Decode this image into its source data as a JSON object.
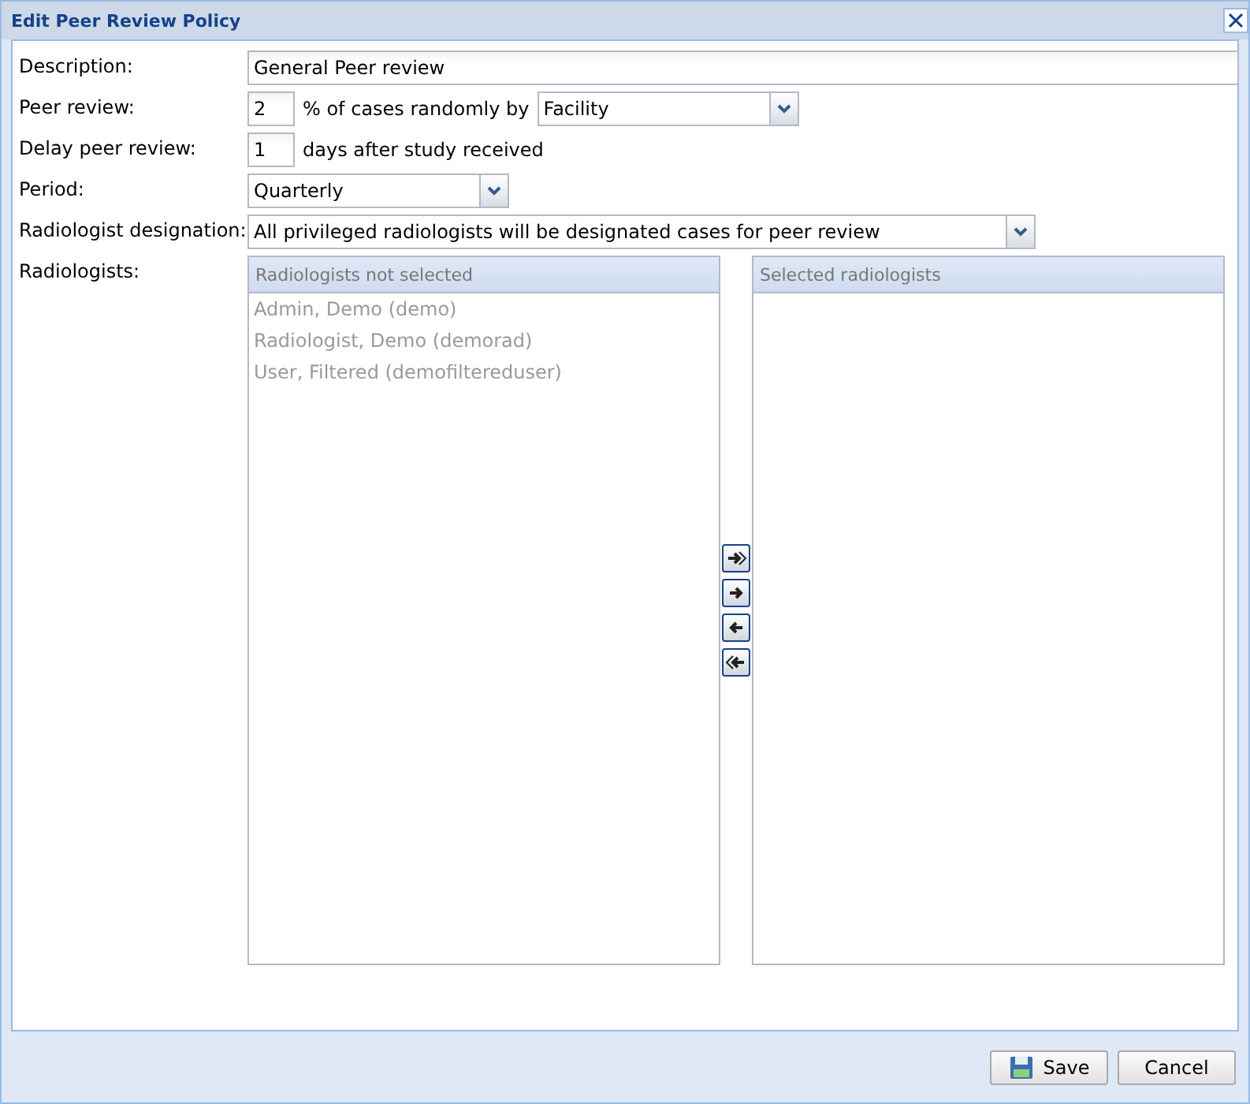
{
  "window": {
    "title": "Edit Peer Review Policy"
  },
  "form": {
    "description": {
      "label": "Description:",
      "value": "General Peer review"
    },
    "peer_review": {
      "label": "Peer review:",
      "value": "2",
      "suffix": "% of cases randomly by",
      "by": "Facility"
    },
    "delay": {
      "label": "Delay peer review:",
      "value": "1",
      "suffix": "days after study received"
    },
    "period": {
      "label": "Period:",
      "value": "Quarterly"
    },
    "designation": {
      "label": "Radiologist designation:",
      "value": "All privileged radiologists will be designated cases for peer review"
    },
    "radiologists": {
      "label": "Radiologists:",
      "available": {
        "title": "Radiologists not selected",
        "items": [
          "Admin, Demo (demo)",
          "Radiologist, Demo (demorad)",
          "User, Filtered (demofiltereduser)"
        ]
      },
      "selected": {
        "title": "Selected radiologists"
      }
    }
  },
  "buttons": [
    {
      "kind": "save",
      "label": "Save"
    },
    {
      "kind": "cancel",
      "label": "Cancel"
    }
  ]
}
